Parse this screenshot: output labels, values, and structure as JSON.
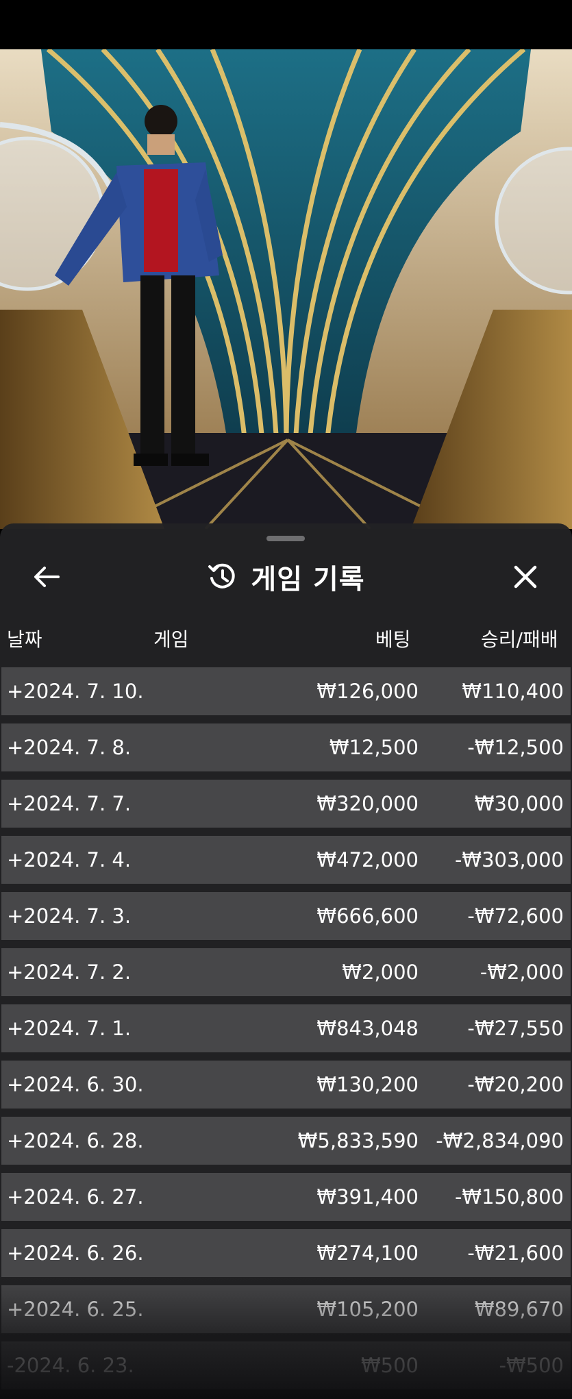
{
  "header": {
    "title": "게임 기록",
    "back_icon": "arrow-left-icon",
    "history_icon": "history-clock-icon",
    "close_icon": "close-icon"
  },
  "columns": {
    "date": "날짜",
    "game": "게임",
    "bet": "베팅",
    "result": "승리/패배"
  },
  "rows": [
    {
      "date": "+2024. 7. 10.",
      "bet": "₩126,000",
      "result": "₩110,400"
    },
    {
      "date": "+2024. 7. 8.",
      "bet": "₩12,500",
      "result": "-₩12,500"
    },
    {
      "date": "+2024. 7. 7.",
      "bet": "₩320,000",
      "result": "₩30,000"
    },
    {
      "date": "+2024. 7. 4.",
      "bet": "₩472,000",
      "result": "-₩303,000"
    },
    {
      "date": "+2024. 7. 3.",
      "bet": "₩666,600",
      "result": "-₩72,600"
    },
    {
      "date": "+2024. 7. 2.",
      "bet": "₩2,000",
      "result": "-₩2,000"
    },
    {
      "date": "+2024. 7. 1.",
      "bet": "₩843,048",
      "result": "-₩27,550"
    },
    {
      "date": "+2024. 6. 30.",
      "bet": "₩130,200",
      "result": "-₩20,200"
    },
    {
      "date": "+2024. 6. 28.",
      "bet": "₩5,833,590",
      "result": "-₩2,834,090"
    },
    {
      "date": "+2024. 6. 27.",
      "bet": "₩391,400",
      "result": "-₩150,800"
    },
    {
      "date": "+2024. 6. 26.",
      "bet": "₩274,100",
      "result": "-₩21,600"
    },
    {
      "date": "+2024. 6. 25.",
      "bet": "₩105,200",
      "result": "₩89,670"
    },
    {
      "date": "-2024. 6. 23.",
      "bet": "₩500",
      "result": "-₩500"
    }
  ],
  "colors": {
    "sheet_bg": "#222224",
    "row_bg": "#474749",
    "text": "#ffffff"
  }
}
